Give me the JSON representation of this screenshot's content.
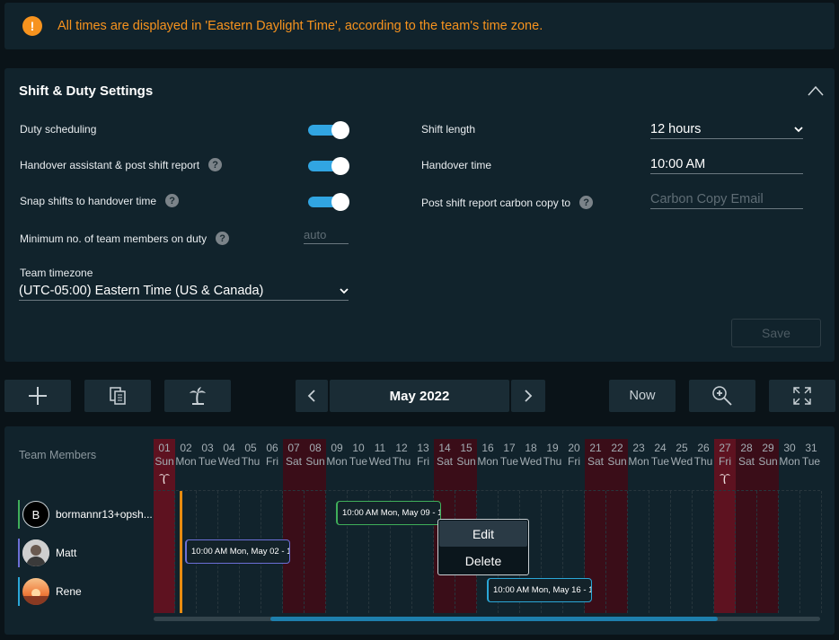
{
  "banner": {
    "message": "All times are displayed in 'Eastern Daylight Time', according to the team's time zone.",
    "icon": "warning-icon"
  },
  "settings": {
    "title": "Shift & Duty Settings",
    "duty_scheduling": {
      "label": "Duty scheduling",
      "on": true
    },
    "handover_assistant": {
      "label": "Handover assistant & post shift report",
      "on": true
    },
    "snap_shifts": {
      "label": "Snap shifts to handover time",
      "on": true
    },
    "min_members": {
      "label": "Minimum no. of team members on duty",
      "placeholder": "auto"
    },
    "timezone": {
      "label": "Team timezone",
      "value": "(UTC-05:00) Eastern Time (US & Canada)"
    },
    "shift_length": {
      "label": "Shift length",
      "value": "12 hours"
    },
    "handover_time": {
      "label": "Handover time",
      "value": "10:00 AM"
    },
    "carbon_copy": {
      "label": "Post shift report carbon copy to",
      "placeholder": "Carbon Copy Email"
    },
    "save_label": "Save"
  },
  "toolbar": {
    "month": "May 2022",
    "now_label": "Now"
  },
  "schedule": {
    "team_members_label": "Team Members",
    "days": [
      {
        "n": "01",
        "d": "Sun",
        "t": "holiday",
        "palm": true
      },
      {
        "n": "02",
        "d": "Mon"
      },
      {
        "n": "03",
        "d": "Tue"
      },
      {
        "n": "04",
        "d": "Wed"
      },
      {
        "n": "05",
        "d": "Thu"
      },
      {
        "n": "06",
        "d": "Fri"
      },
      {
        "n": "07",
        "d": "Sat",
        "t": "weekend"
      },
      {
        "n": "08",
        "d": "Sun",
        "t": "weekend"
      },
      {
        "n": "09",
        "d": "Mon"
      },
      {
        "n": "10",
        "d": "Tue"
      },
      {
        "n": "11",
        "d": "Wed"
      },
      {
        "n": "12",
        "d": "Thu"
      },
      {
        "n": "13",
        "d": "Fri"
      },
      {
        "n": "14",
        "d": "Sat",
        "t": "weekend"
      },
      {
        "n": "15",
        "d": "Sun",
        "t": "weekend"
      },
      {
        "n": "16",
        "d": "Mon"
      },
      {
        "n": "17",
        "d": "Tue"
      },
      {
        "n": "18",
        "d": "Wed"
      },
      {
        "n": "19",
        "d": "Thu"
      },
      {
        "n": "20",
        "d": "Fri"
      },
      {
        "n": "21",
        "d": "Sat",
        "t": "weekend"
      },
      {
        "n": "22",
        "d": "Sun",
        "t": "weekend"
      },
      {
        "n": "23",
        "d": "Mon"
      },
      {
        "n": "24",
        "d": "Tue"
      },
      {
        "n": "25",
        "d": "Wed"
      },
      {
        "n": "26",
        "d": "Thu"
      },
      {
        "n": "27",
        "d": "Fri",
        "t": "holiday",
        "palm": true
      },
      {
        "n": "28",
        "d": "Sat",
        "t": "weekend"
      },
      {
        "n": "29",
        "d": "Sun",
        "t": "weekend"
      },
      {
        "n": "30",
        "d": "Mon"
      },
      {
        "n": "31",
        "d": "Tue"
      }
    ],
    "members": [
      {
        "name": "bormannr13+opsh...",
        "initial": "B",
        "color": "#3fae5a"
      },
      {
        "name": "Matt",
        "color": "#6b6fd6"
      },
      {
        "name": "Rene",
        "color": "#2aa7d8"
      }
    ],
    "shifts": [
      {
        "label": "10:00 AM Mon, May 09 - 1",
        "color": "#3fae5a"
      },
      {
        "label": "10:00 AM Mon, May 02 - 1",
        "color": "#6b6fd6"
      },
      {
        "label": "10:00 AM Mon, May 16 - 1",
        "color": "#2aa7d8"
      }
    ],
    "context_menu": {
      "edit": "Edit",
      "delete": "Delete"
    }
  }
}
